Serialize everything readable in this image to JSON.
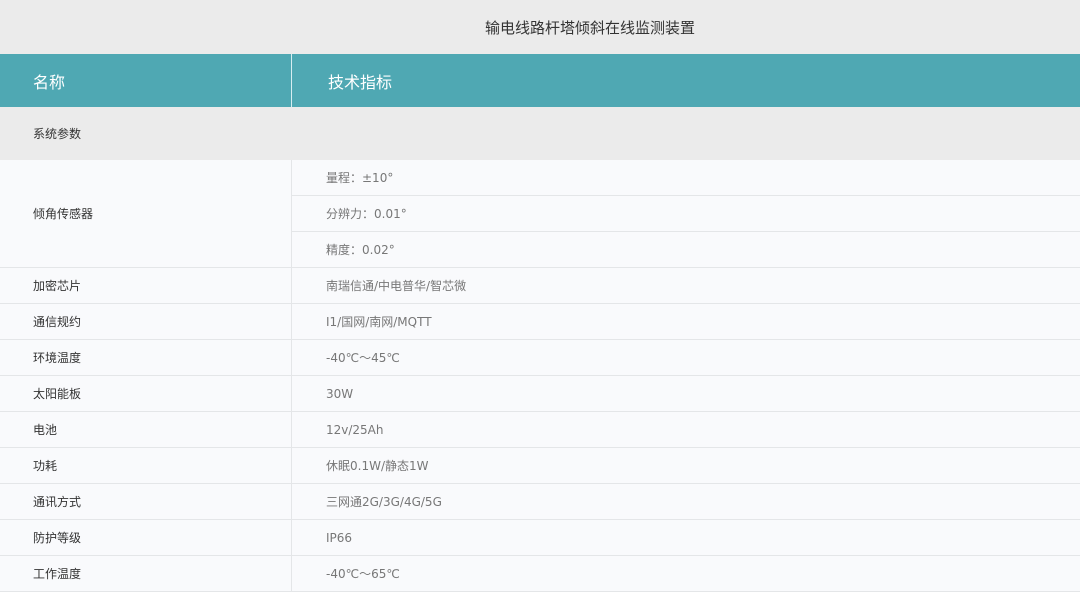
{
  "title": "输电线路杆塔倾斜在线监测装置",
  "header": {
    "col1": "名称",
    "col2": "技术指标"
  },
  "section": "系统参数",
  "rows": [
    {
      "name": "倾角传感器",
      "values": [
        "量程：±10°",
        "分辨力：0.01°",
        "精度：0.02°"
      ]
    },
    {
      "name": "加密芯片",
      "values": [
        "南瑞信通/中电普华/智芯微"
      ]
    },
    {
      "name": "通信规约",
      "values": [
        "I1/国网/南网/MQTT"
      ]
    },
    {
      "name": "环境温度",
      "values": [
        "-40℃～45℃"
      ]
    },
    {
      "name": "太阳能板",
      "values": [
        "30W"
      ]
    },
    {
      "name": "电池",
      "values": [
        "12v/25Ah"
      ]
    },
    {
      "name": "功耗",
      "values": [
        "休眠0.1W/静态1W"
      ]
    },
    {
      "name": "通讯方式",
      "values": [
        "三网通2G/3G/4G/5G"
      ]
    },
    {
      "name": "防护等级",
      "values": [
        "IP66"
      ]
    },
    {
      "name": "工作温度",
      "values": [
        "-40℃～65℃"
      ]
    }
  ]
}
